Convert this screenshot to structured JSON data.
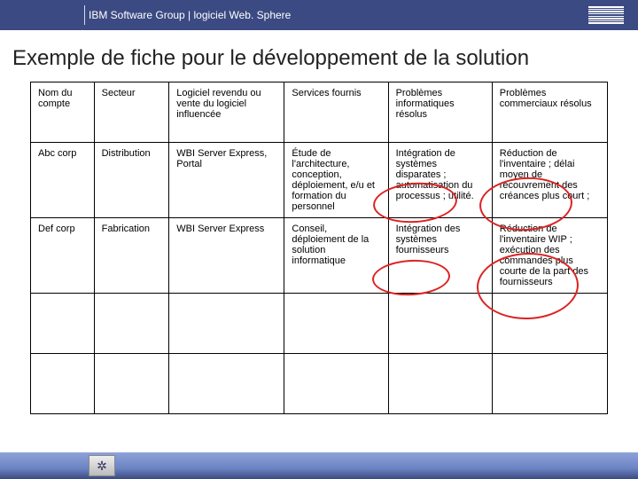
{
  "header": {
    "breadcrumb": "IBM Software Group | logiciel Web. Sphere",
    "logo_name": "IBM"
  },
  "page_title": "Exemple de fiche pour le développement de la solution",
  "table": {
    "headers": [
      "Nom du compte",
      "Secteur",
      "Logiciel revendu ou vente du logiciel influencée",
      "Services fournis",
      "Problèmes informatiques résolus",
      "Problèmes commerciaux résolus"
    ],
    "rows": [
      {
        "account": "Abc corp",
        "sector": "Distribution",
        "software": "WBI Server Express, Portal",
        "services": "Étude de l'architecture, conception, déploiement, e/u et formation du personnel",
        "it_problems": "Intégration de systèmes disparates ; automatisation du processus ; utilité.",
        "biz_problems": "Réduction de l'inventaire ; délai moyen de recouvrement des créances plus court ;"
      },
      {
        "account": "Def corp",
        "sector": "Fabrication",
        "software": "WBI Server Express",
        "services": "Conseil, déploiement de la solution informatique",
        "it_problems": "Intégration des systèmes fournisseurs",
        "biz_problems": "Réduction de l'inventaire WIP ; exécution des commandes plus courte de la part des fournisseurs"
      },
      {
        "account": "",
        "sector": "",
        "software": "",
        "services": "",
        "it_problems": "",
        "biz_problems": ""
      },
      {
        "account": "",
        "sector": "",
        "software": "",
        "services": "",
        "it_problems": "",
        "biz_problems": ""
      }
    ]
  },
  "footer": {
    "badge_glyph": "✲"
  }
}
